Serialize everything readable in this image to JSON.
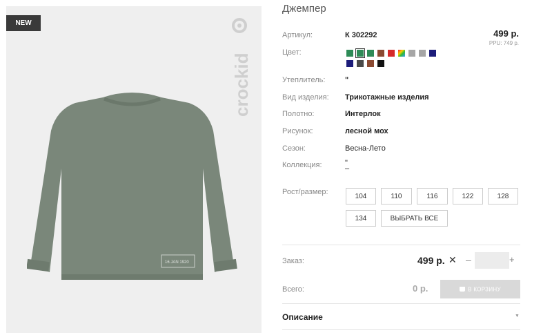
{
  "badge": "NEW",
  "brand": "crockid",
  "print_text": "16 JAN 1920",
  "title": "Джемпер",
  "article": {
    "label": "Артикул:",
    "value": "К 302292"
  },
  "price": "499 р.",
  "ppu": "PPU: 749 р.",
  "color_label": "Цвет:",
  "swatches": [
    "#2e8b57",
    "#2e8b57",
    "#2e8b57",
    "#8b4a32",
    "#d62a2a",
    "rainbow",
    "#a6a6a6",
    "#a6a6a6",
    "#1c1c7a",
    "#1c1c7a",
    "#4a4a4a",
    "#8b4a32",
    "#111111"
  ],
  "attributes": [
    {
      "label": "Утеплитель:",
      "value": "\"",
      "bold": true
    },
    {
      "label": "Вид изделия:",
      "value": "Трикотажные изделия",
      "bold": true
    },
    {
      "label": "Полотно:",
      "value": "Интерлок",
      "bold": true
    },
    {
      "label": "Рисунок:",
      "value": "лесной мох",
      "bold": true
    },
    {
      "label": "Сезон:",
      "value": "Весна-Лето",
      "bold": false
    },
    {
      "label": "Коллекция:",
      "value": "\"",
      "bold": false
    }
  ],
  "collection_dash": "–",
  "size_label": "Рост/размер:",
  "sizes": [
    "104",
    "110",
    "116",
    "122",
    "128",
    "134"
  ],
  "select_all": "ВЫБРАТЬ ВСЕ",
  "order": {
    "label": "Заказ:",
    "price": "499 р.",
    "times": "✕",
    "minus": "–",
    "plus": "+"
  },
  "total": {
    "label": "Всего:",
    "value": "0 р."
  },
  "cart_button": "В КОРЗИНУ",
  "description_label": "Описание",
  "colors": {
    "accent_swatch_selected": "#2e8b57",
    "shirt": "#7a877a",
    "disabled_button": "#d9d9d9"
  }
}
